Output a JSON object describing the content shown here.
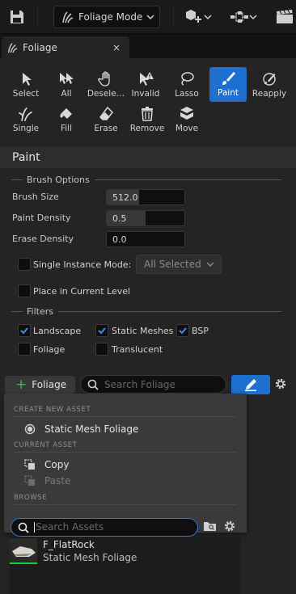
{
  "toolbar": {
    "mode_label": "Foliage Mode",
    "icons": [
      "save-icon",
      "foliage-icon",
      "add-actor-icon",
      "blueprint-icon",
      "cinematics-icon"
    ]
  },
  "tab": {
    "title": "Foliage",
    "close": "×"
  },
  "tools": {
    "select": "Select",
    "all": "All",
    "deselect": "Desele…",
    "invalid": "Invalid",
    "lasso": "Lasso",
    "paint": "Paint",
    "reapply": "Reapply",
    "single": "Single",
    "fill": "Fill",
    "erase": "Erase",
    "remove": "Remove",
    "move": "Move",
    "active": "paint"
  },
  "paint": {
    "title": "Paint",
    "brush_options": "Brush Options",
    "brush_size_label": "Brush Size",
    "brush_size": "512.0",
    "brush_size_fill": 0.42,
    "paint_density_label": "Paint Density",
    "paint_density": "0.5",
    "paint_density_fill": 0.5,
    "erase_density_label": "Erase Density",
    "erase_density": "0.0",
    "single_instance_label": "Single Instance Mode:",
    "single_instance_value": "All Selected",
    "place_current_level": "Place in Current Level",
    "filters": "Filters",
    "landscape": "Landscape",
    "static_meshes": "Static Meshes",
    "bsp": "BSP",
    "foliage": "Foliage",
    "translucent": "Translucent"
  },
  "foliage_bar": {
    "add_label": "Foliage",
    "search_placeholder": "Search Foliage"
  },
  "popup": {
    "create_new_asset": "CREATE NEW ASSET",
    "static_mesh_foliage": "Static Mesh Foliage",
    "current_asset": "CURRENT ASSET",
    "copy": "Copy",
    "paste": "Paste",
    "browse": "BROWSE",
    "search_placeholder": "Search Assets"
  },
  "assets": [
    {
      "name": "F_FlatRock",
      "type": "Static Mesh Foliage"
    }
  ],
  "colors": {
    "accent": "#1d6fd0",
    "check": "#3a8ee6",
    "add": "#3fb34f",
    "thumb_bar": "#1bcf3b"
  }
}
